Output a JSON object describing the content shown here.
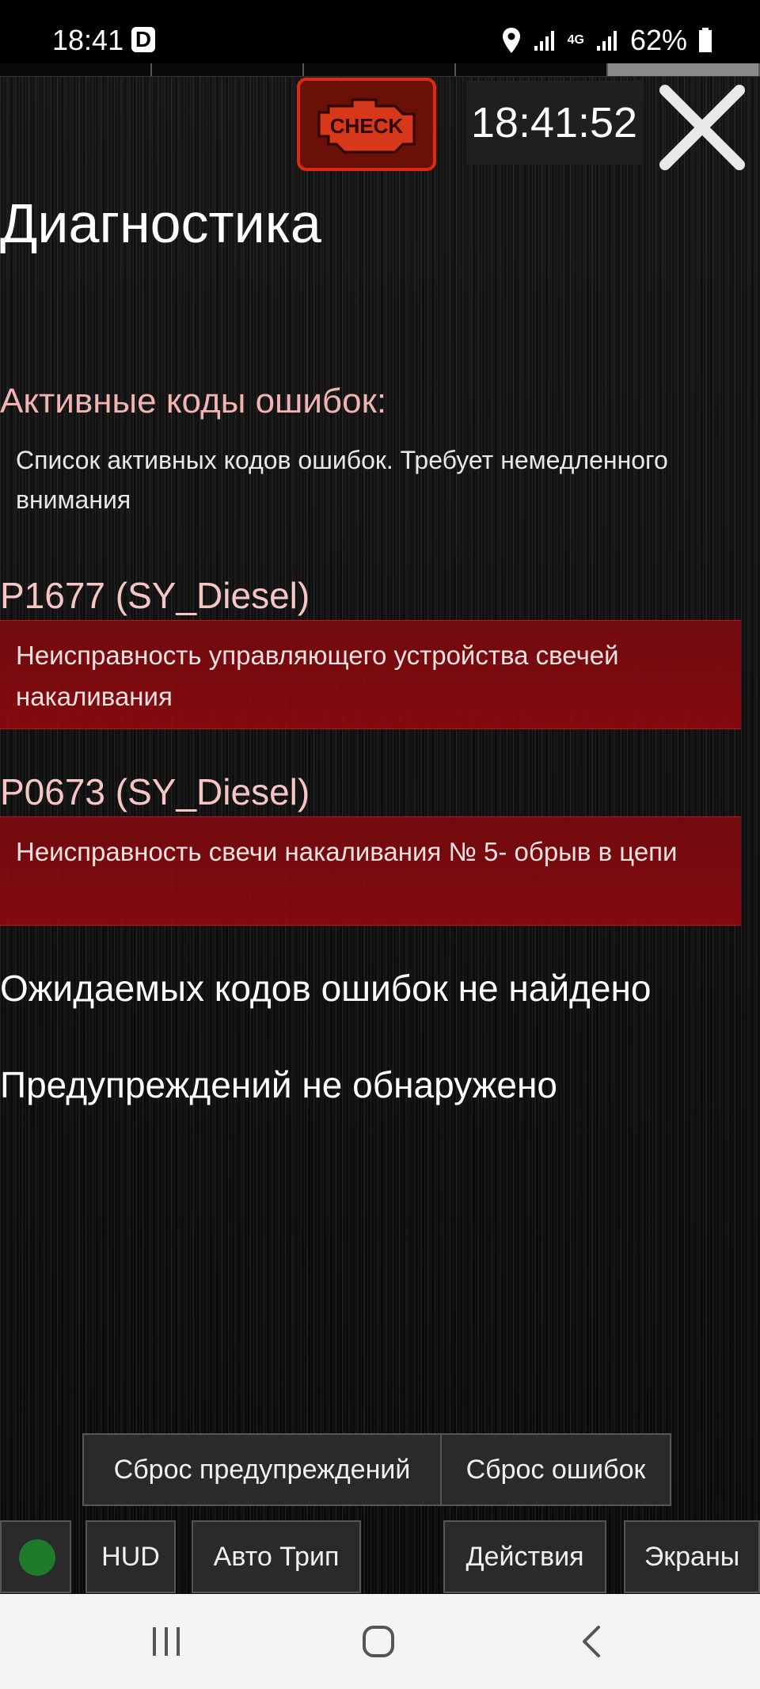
{
  "status_bar": {
    "time": "18:41",
    "d_badge": "D",
    "battery_percent": "62%",
    "network_label": "4G"
  },
  "header": {
    "check_icon_label": "CHECK",
    "clock": "18:41:52"
  },
  "page": {
    "title": "Диагностика",
    "active_section": {
      "label": "Активные коды ошибок:",
      "description": "Список активных кодов ошибок. Требует немедленного внимания"
    },
    "codes": [
      {
        "code": "P1677 (SY_Diesel)",
        "description": "Неисправность управляющего устройства свечей накаливания"
      },
      {
        "code": "P0673 (SY_Diesel)",
        "description": "Неисправность свечи накаливания № 5- обрыв в цепи"
      }
    ],
    "expected_codes_text": "Ожидаемых кодов ошибок не найдено",
    "warnings_text": "Предупреждений не обнаружено"
  },
  "actions": {
    "reset_warnings": "Сброс предупреждений",
    "reset_errors": "Сброс ошибок"
  },
  "bottom_tabs": {
    "hud": "HUD",
    "auto_trip": "Авто Трип",
    "actions": "Действия",
    "screens": "Экраны"
  },
  "colors": {
    "check_red": "#e02a10",
    "error_box": "#8a0a10",
    "indicator_green": "#1f7a2a"
  }
}
